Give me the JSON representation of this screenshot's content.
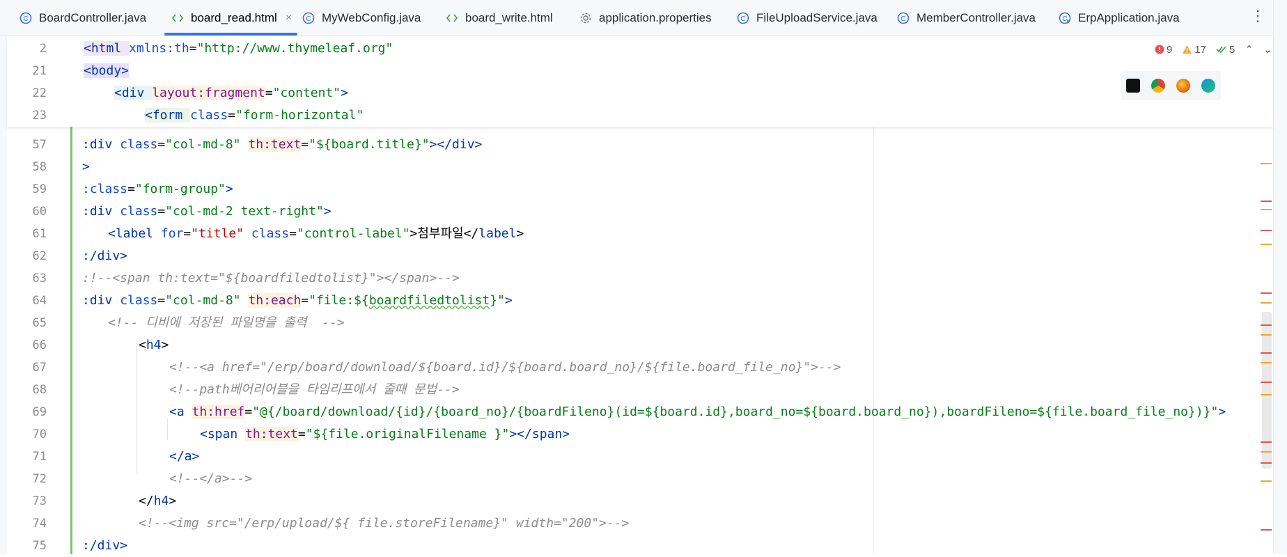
{
  "tabs": [
    {
      "label": "BoardController.java",
      "icon": "java-class-icon",
      "active": false
    },
    {
      "label": "board_read.html",
      "icon": "html-file-icon",
      "active": true,
      "close": "×"
    },
    {
      "label": "MyWebConfig.java",
      "icon": "java-class-icon",
      "active": false
    },
    {
      "label": "board_write.html",
      "icon": "html-file-icon",
      "active": false
    },
    {
      "label": "application.properties",
      "icon": "gear-icon",
      "active": false
    },
    {
      "label": "FileUploadService.java",
      "icon": "java-class-icon",
      "active": false
    },
    {
      "label": "MemberController.java",
      "icon": "java-class-icon",
      "active": false
    },
    {
      "label": "ErpApplication.java",
      "icon": "java-run-class-icon",
      "active": false
    }
  ],
  "inspections": {
    "errors": "9",
    "warnings": "17",
    "weak": "5"
  },
  "browsers": [
    "intellij-icon",
    "chrome-icon",
    "firefox-icon",
    "edge-icon"
  ],
  "sticky": [
    {
      "num": "2"
    },
    {
      "num": "21"
    },
    {
      "num": "22"
    },
    {
      "num": "23"
    }
  ],
  "lines": [
    {
      "num": "57"
    },
    {
      "num": "58"
    },
    {
      "num": "59"
    },
    {
      "num": "60"
    },
    {
      "num": "61"
    },
    {
      "num": "62"
    },
    {
      "num": "63"
    },
    {
      "num": "64"
    },
    {
      "num": "65"
    },
    {
      "num": "66"
    },
    {
      "num": "67"
    },
    {
      "num": "68"
    },
    {
      "num": "69"
    },
    {
      "num": "70"
    },
    {
      "num": "71"
    },
    {
      "num": "72"
    },
    {
      "num": "73"
    },
    {
      "num": "74"
    },
    {
      "num": "75"
    }
  ],
  "code": {
    "s2": [
      "<html ",
      "xmlns:th",
      "=",
      "\"http://www.thymeleaf.org\""
    ],
    "s21": [
      "<body>"
    ],
    "s22": [
      "<div ",
      "layout:fragment",
      "=",
      "\"content\"",
      ">"
    ],
    "s23": [
      "<form ",
      "class",
      "=",
      "\"form-horizontal\""
    ],
    "l57": [
      ":div ",
      "class",
      "=",
      "\"col-md-8\"",
      " ",
      "th:text",
      "=",
      "\"${board.title}\"",
      "></div>"
    ],
    "l58": [
      ">"
    ],
    "l59": [
      ":class",
      "=",
      "\"form-group\"",
      ">"
    ],
    "l60": [
      ":div ",
      "class",
      "=",
      "\"col-md-2 text-right\"",
      ">"
    ],
    "l61": [
      "<label ",
      "for",
      "=",
      "\"title\"",
      " ",
      "class",
      "=",
      "\"control-label\"",
      ">첨부파일</",
      "label",
      ">"
    ],
    "l62": [
      ":/div>"
    ],
    "l63": [
      ":!--<span th:text=\"${boardfiledtolist}\"></span>-->"
    ],
    "l64": [
      ":div ",
      "class",
      "=",
      "\"col-md-8\"",
      " ",
      "th:each",
      "=",
      "\"file:${",
      "boardfiledtolist",
      "}\"",
      ">"
    ],
    "l65": [
      "<!-- 디비에 저장된 파일명을 출력  -->"
    ],
    "l66": [
      "<",
      "h4",
      ">"
    ],
    "l67": [
      "<!--<a href=\"/erp/board/download/${board.id}/${board.board_no}/${file.board_file_no}\">-->"
    ],
    "l68": [
      "<!--path베어리어블을 타임리프에서 줄때 문법-->"
    ],
    "l69": [
      "<a ",
      "th:href",
      "=",
      "\"@{/board/download/{id}/{board_no}/{boardFileno}(id=${board.id},board_no=${board.board_no}),boardFileno=${file.board_file_no})}\"",
      ">"
    ],
    "l70": [
      "<span ",
      "th:text",
      "=",
      "\"${file.originalFilename }\"",
      "></span>"
    ],
    "l71": [
      "</a>"
    ],
    "l72": [
      "<!--</a>-->"
    ],
    "l73": [
      "</",
      "h4",
      ">"
    ],
    "l74": [
      "<!--<img src=\"/erp/upload/${ file.storeFilename}\" width=\"200\">-->"
    ],
    "l75": [
      ":/div>"
    ]
  }
}
